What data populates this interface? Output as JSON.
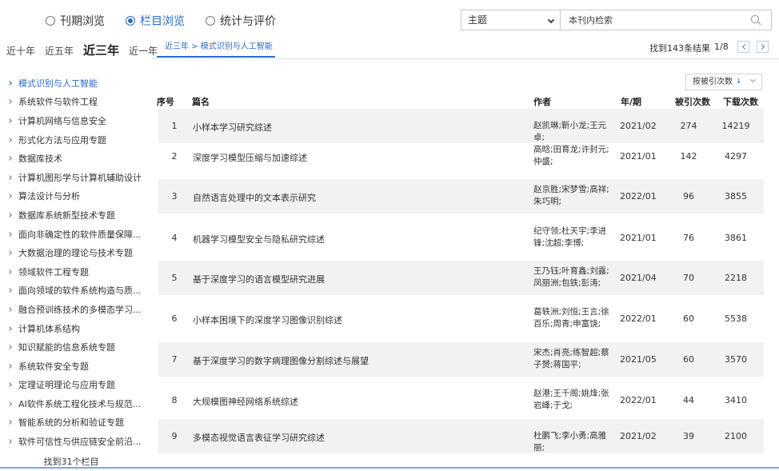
{
  "view_tabs": [
    {
      "label": "刊期浏览",
      "selected": false
    },
    {
      "label": "栏目浏览",
      "selected": true
    },
    {
      "label": "统计与评价",
      "selected": false
    }
  ],
  "search": {
    "scope_value": "主题",
    "placeholder": "本刊内检索"
  },
  "year_filters": [
    {
      "label": "近十年",
      "active": false
    },
    {
      "label": "近五年",
      "active": false
    },
    {
      "label": "近三年",
      "active": true
    },
    {
      "label": "近一年",
      "active": false
    }
  ],
  "breadcrumb": "近三年 > 模式识别与人工智能",
  "results": {
    "count_text": "找到143条结果",
    "page_text": "1/8"
  },
  "sidebar": {
    "items": [
      {
        "label": "模式识别与人工智能",
        "active": true
      },
      {
        "label": "系统软件与软件工程",
        "active": false
      },
      {
        "label": "计算机网络与信息安全",
        "active": false
      },
      {
        "label": "形式化方法与应用专题",
        "active": false
      },
      {
        "label": "数据库技术",
        "active": false
      },
      {
        "label": "计算机图形学与计算机辅助设计",
        "active": false
      },
      {
        "label": "算法设计与分析",
        "active": false
      },
      {
        "label": "数据库系统新型技术专题",
        "active": false
      },
      {
        "label": "面向非确定性的软件质量保障...",
        "active": false
      },
      {
        "label": "大数据治理的理论与技术专题",
        "active": false
      },
      {
        "label": "领域软件工程专题",
        "active": false
      },
      {
        "label": "面向领域的软件系统构造与质...",
        "active": false
      },
      {
        "label": "融合预训练技术的多模态学习...",
        "active": false
      },
      {
        "label": "计算机体系结构",
        "active": false
      },
      {
        "label": "知识赋能的信息系统专题",
        "active": false
      },
      {
        "label": "系统软件安全专题",
        "active": false
      },
      {
        "label": "定理证明理论与应用专题",
        "active": false
      },
      {
        "label": "AI软件系统工程化技术与规范...",
        "active": false
      },
      {
        "label": "智能系统的分析和验证专题",
        "active": false
      },
      {
        "label": "软件可信性与供应链安全前沿...",
        "active": false
      }
    ],
    "footer": "找到31个栏目"
  },
  "sort": {
    "label": "按被引次数",
    "arrow": "↓"
  },
  "table": {
    "headers": {
      "no": "序号",
      "title": "篇名",
      "author": "作者",
      "issue": "年/期",
      "cited": "被引次数",
      "downloads": "下载次数"
    },
    "rows": [
      {
        "no": "1",
        "title": "小样本学习研究综述",
        "author": "赵凯琳;靳小龙;王元卓;",
        "issue": "2021/02",
        "cited": "274",
        "downloads": "14219"
      },
      {
        "no": "2",
        "title": "深度学习模型压缩与加速综述",
        "author": "高晗;田育龙;许封元;仲盛;",
        "issue": "2021/01",
        "cited": "142",
        "downloads": "4297"
      },
      {
        "no": "3",
        "title": "自然语言处理中的文本表示研究",
        "author": "赵京胜;宋梦雪;高祥;朱巧明;",
        "issue": "2022/01",
        "cited": "96",
        "downloads": "3855"
      },
      {
        "no": "4",
        "title": "机器学习模型安全与隐私研究综述",
        "author": "纪守领;杜天宇;李进锋;沈超;李博;",
        "issue": "2021/01",
        "cited": "76",
        "downloads": "3861"
      },
      {
        "no": "5",
        "title": "基于深度学习的语言模型研究进展",
        "author": "王乃钰;叶育鑫;刘露;凤丽洲;包铁;彭涛;",
        "issue": "2021/04",
        "cited": "70",
        "downloads": "2218"
      },
      {
        "no": "6",
        "title": "小样本困境下的深度学习图像识别综述",
        "author": "葛轶洲;刘恒;王言;徐百乐;周青;申富饶;",
        "issue": "2022/01",
        "cited": "60",
        "downloads": "5538"
      },
      {
        "no": "7",
        "title": "基于深度学习的数字病理图像分割综述与展望",
        "author": "宋杰;肖亮;练智超;蔡子赟;蒋国平;",
        "issue": "2021/05",
        "cited": "60",
        "downloads": "3570"
      },
      {
        "no": "8",
        "title": "大规模图神经网络系统综述",
        "author": "赵港;王千阁;姚烽;张岩峰;于戈;",
        "issue": "2022/01",
        "cited": "44",
        "downloads": "3410"
      },
      {
        "no": "9",
        "title": "多模态视觉语言表征学习研究综述",
        "author": "杜鹏飞;李小勇;高雅丽;",
        "issue": "2021/02",
        "cited": "39",
        "downloads": "2100"
      }
    ]
  },
  "colors": {
    "accent": "#2b6cc4",
    "row_alt": "#f2f2f2"
  }
}
